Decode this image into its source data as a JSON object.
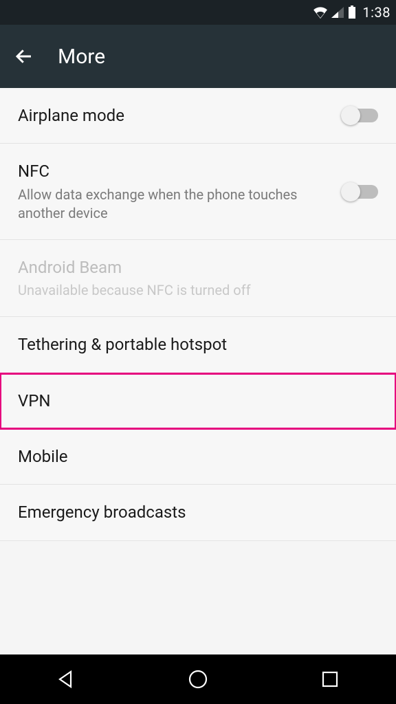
{
  "statusbar": {
    "time": "1:38"
  },
  "appbar": {
    "title": "More"
  },
  "items": [
    {
      "label": "Airplane mode",
      "sub": "",
      "toggle": true,
      "disabled": false,
      "highlight": false
    },
    {
      "label": "NFC",
      "sub": "Allow data exchange when the phone touches another device",
      "toggle": true,
      "disabled": false,
      "highlight": false
    },
    {
      "label": "Android Beam",
      "sub": "Unavailable because NFC is turned off",
      "toggle": false,
      "disabled": true,
      "highlight": false
    },
    {
      "label": "Tethering & portable hotspot",
      "sub": "",
      "toggle": false,
      "disabled": false,
      "highlight": false
    },
    {
      "label": "VPN",
      "sub": "",
      "toggle": false,
      "disabled": false,
      "highlight": true
    },
    {
      "label": "Mobile",
      "sub": "",
      "toggle": false,
      "disabled": false,
      "highlight": false
    },
    {
      "label": "Emergency broadcasts",
      "sub": "",
      "toggle": false,
      "disabled": false,
      "highlight": false
    }
  ]
}
